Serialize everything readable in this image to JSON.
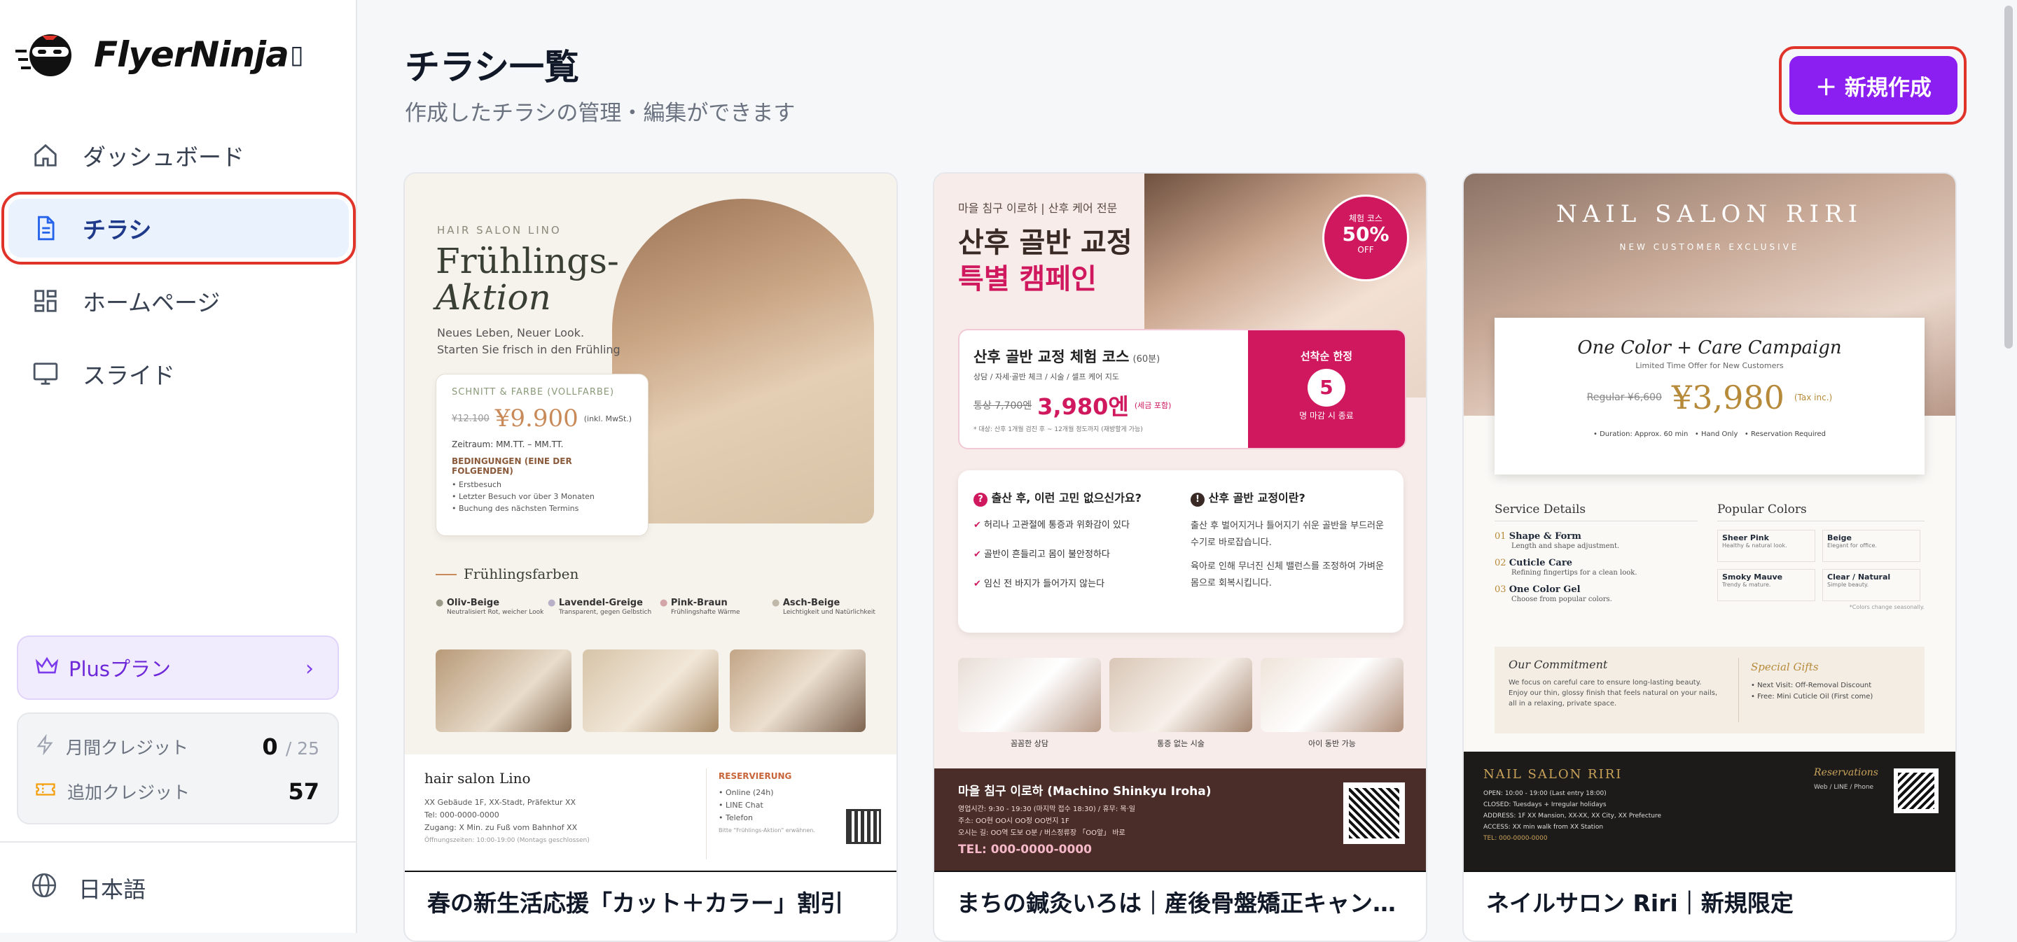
{
  "app": {
    "name": "FlyerNinja"
  },
  "nav": {
    "items": [
      {
        "label": "ダッシュボード",
        "icon": "home-icon"
      },
      {
        "label": "チラシ",
        "icon": "document-icon"
      },
      {
        "label": "ホームページ",
        "icon": "grid-icon"
      },
      {
        "label": "スライド",
        "icon": "monitor-icon"
      }
    ]
  },
  "plan": {
    "label": "Plusプラン"
  },
  "credits": {
    "monthly_label": "月間クレジット",
    "monthly_used": "0",
    "monthly_total": "/ 25",
    "extra_label": "追加クレジット",
    "extra_value": "57"
  },
  "language": {
    "label": "日本語"
  },
  "page": {
    "title": "チラシ一覧",
    "subtitle": "作成したチラシの管理・編集ができます",
    "new_button": "＋ 新規作成"
  },
  "colors": {
    "accent": "#8b1ef0",
    "highlight": "#e0342a",
    "active_bg": "#eaf2fd"
  },
  "cards": [
    {
      "caption": "春の新生活応援「カット＋カラー」割引",
      "flyer": {
        "brand": "HAIR SALON LINO",
        "title1": "Frühlings-",
        "title2": "Aktion",
        "sub1": "Neues Leben, Neuer Look.",
        "sub2": "Starten Sie frisch in den Frühling",
        "box_head": "SCHNITT & FARBE (VOLLFARBE)",
        "old_price": "¥12.100",
        "price": "¥9.900",
        "price_note": "(inkl. MwSt.)",
        "period": "Zeitraum: MM.TT. – MM.TT.",
        "cond_head": "BEDINGUNGEN (EINE DER FOLGENDEN)",
        "cond1": "Erstbesuch",
        "cond2": "Letzter Besuch vor über 3 Monaten",
        "cond3": "Buchung des nächsten Termins",
        "colors_head": "Frühlingsfarben",
        "c1": "Oliv-Beige",
        "c1d": "Neutralisiert Rot, weicher Look",
        "c2": "Lavendel-Greige",
        "c2d": "Transparent, gegen Gelbstich",
        "c3": "Pink-Braun",
        "c3d": "Frühlingshafte Wärme",
        "c4": "Asch-Beige",
        "c4d": "Leichtigkeit und Natürlichkeit",
        "footer_name": "hair salon Lino",
        "addr1": "XX Gebäude 1F, XX-Stadt, Präfektur XX",
        "addr2": "Tel: 000-0000-0000",
        "addr3": "Zugang: X Min. zu Fuß vom Bahnhof XX",
        "hours": "Öffnungszeiten: 10:00-19:00 (Montags geschlossen)",
        "res_head": "RESERVIERUNG",
        "res1": "Online (24h)",
        "res2": "LINE Chat",
        "res3": "Telefon",
        "res_note": "Bitte \"Frühlings-Aktion\" erwähnen."
      }
    },
    {
      "caption": "まちの鍼灸いろは｜産後骨盤矯正キャンペ...",
      "flyer": {
        "top": "마을 침구 이로하 | 산후 케어 전문",
        "title1": "산후 골반 교정",
        "title2": "특별 캠페인",
        "badge1": "체험 코스",
        "badge2": "50%",
        "badge3": "OFF",
        "course": "산후 골반 교정 체험 코스",
        "course_min": "(60분)",
        "course_items": "상담 / 자세·골반 체크 / 시술 / 셀프 케어 지도",
        "old_price": "통상 7,700엔",
        "price": "3,980엔",
        "price_note": "(세금 포함)",
        "target": "* 대상: 산후 1개월 검진 후 ~ 12개월 정도까지 (재방할게 가능)",
        "limit_head": "선착순 한정",
        "limit_num": "5",
        "limit_tail": "명 마감 시 종료",
        "q_head": "출산 후, 이런 고민 없으신가요?",
        "q1": "허리나 고관절에 통증과 위화감이 있다",
        "q2": "골반이 흔들리고 몸이 불안정하다",
        "q3": "임신 전 바지가 들어가지 않는다",
        "a_head": "산후 골반 교정이란?",
        "a_text1": "출산 후 벌어지거나 틀어지기 쉬운 골반을 부드러운 수기로 바로잡습니다.",
        "a_text2": "육아로 인해 무너진 신체 밸런스를 조정하여 가벼운 몸으로 회복시킵니다.",
        "p1": "꼼꼼한 상담",
        "p2": "통증 없는 시술",
        "p3": "아이 동반 가능",
        "footer_name": "마을 침구 이로하 (Machino Shinkyu Iroha)",
        "f1": "영업시간: 9:30 - 19:30 (마지막 접수 18:30) / 휴무: 목·일",
        "f2": "주소: OO현 OO시 OO정 OO번지 1F",
        "f3": "오시는 길: OO역 도보 O분 / 버스정류장 「OO앞」 바로",
        "tel": "TEL: 000-0000-0000"
      }
    },
    {
      "caption": "ネイルサロン Riri｜新規限定",
      "flyer": {
        "brand": "NAIL SALON RIRI",
        "brand_sub": "NEW CUSTOMER EXCLUSIVE",
        "campaign": "One Color + Care Campaign",
        "campaign_sub": "Limited Time Offer for New Customers",
        "old_price": "Regular ¥6,600",
        "price": "¥3,980",
        "tax": "(Tax inc.)",
        "m1": "Duration: Approx. 60 min",
        "m2": "Hand Only",
        "m3": "Reservation Required",
        "svc_head": "Service Details",
        "s1": "Shape & Form",
        "s1d": "Length and shape adjustment.",
        "s2": "Cuticle Care",
        "s2d": "Refining fingertips for a clean look.",
        "s3": "One Color Gel",
        "s3d": "Choose from popular colors.",
        "pop_head": "Popular Colors",
        "pc1": "Sheer Pink",
        "pc1d": "Healthy & natural look.",
        "pc2": "Beige",
        "pc2d": "Elegant for office.",
        "pc3": "Smoky Mauve",
        "pc3d": "Trendy & mature.",
        "pc4": "Clear / Natural",
        "pc4d": "Simple beauty.",
        "pc_note": "*Colors change seasonally.",
        "commit_head": "Our Commitment",
        "commit_text": "We focus on careful care to ensure long-lasting beauty. Enjoy our thin, glossy finish that feels natural on your nails, all in a relaxing, private space.",
        "gift_head": "Special Gifts",
        "gift1": "Next Visit: Off-Removal Discount",
        "gift2": "Free: Mini Cuticle Oil (First come)",
        "footer_brand": "NAIL SALON RIRI",
        "fo1": "OPEN: 10:00 - 19:00 (Last entry 18:00)",
        "fo2": "CLOSED: Tuesdays + Irregular holidays",
        "fo3": "ADDRESS: 1F XX Mansion, XX-XX, XX City, XX Prefecture",
        "fo4": "ACCESS: XX min walk from XX Station",
        "fo5": "TEL: 000-0000-0000",
        "res_head": "Reservations",
        "res_text": "Web / LINE / Phone"
      }
    }
  ]
}
